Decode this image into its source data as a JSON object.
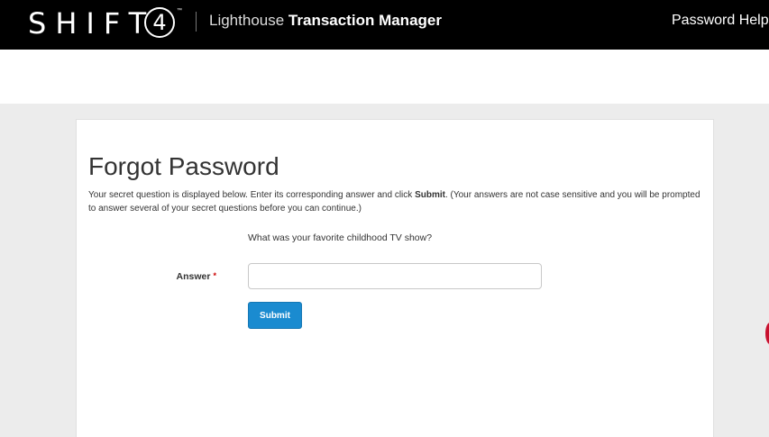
{
  "header": {
    "logo_text": "SHIFT",
    "logo_digit": "4",
    "logo_tm": "™",
    "app_name_light": "Lighthouse",
    "app_name_bold": "Transaction Manager",
    "password_help": "Password Help"
  },
  "page": {
    "title": "Forgot Password",
    "description_prefix": "Your secret question is displayed below. Enter its corresponding answer and click ",
    "description_bold": "Submit",
    "description_suffix": ". (Your answers are not case sensitive and you will be prompted to answer several of your secret questions before you can continue.)"
  },
  "form": {
    "question": "What was your favorite childhood TV show?",
    "answer_label": "Answer",
    "required_marker": "*",
    "answer_value": "",
    "submit_label": "Submit"
  },
  "colors": {
    "header_bg": "#000000",
    "accent_blue": "#1a8bd0",
    "required_red": "#cc0000",
    "page_bg": "#ececec"
  }
}
